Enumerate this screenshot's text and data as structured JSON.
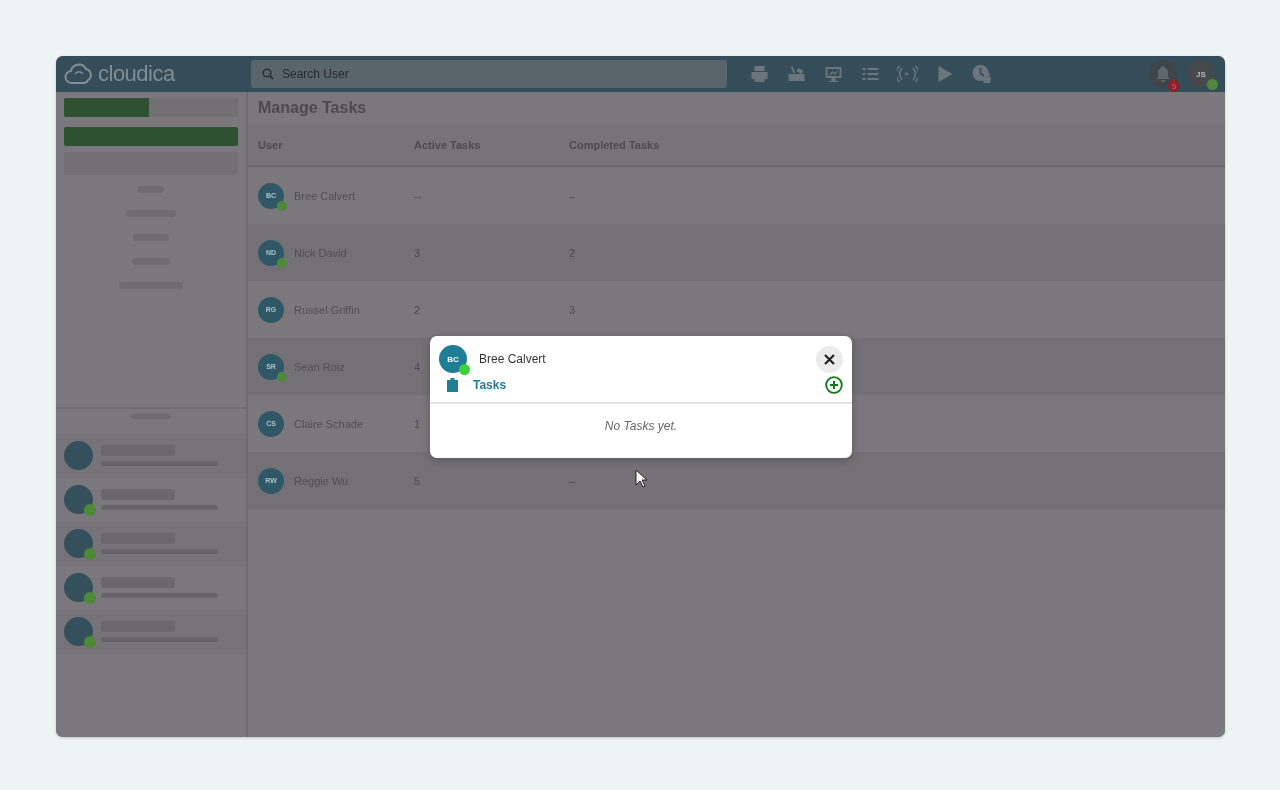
{
  "header": {
    "logo": "cloudica",
    "search": {
      "placeholder": "Search User"
    },
    "notifications": {
      "count": "5"
    },
    "account": {
      "initials": "JS",
      "online": true
    }
  },
  "sidebar": {
    "progress": {
      "level": 0.49
    },
    "contacts": [
      {
        "online": false
      },
      {
        "online": true
      },
      {
        "online": true
      },
      {
        "online": true
      },
      {
        "online": true
      }
    ]
  },
  "page": {
    "title": "Manage Tasks",
    "table": {
      "columns": [
        "User",
        "Active Tasks",
        "Completed Tasks"
      ],
      "rows": [
        {
          "initials": "BC",
          "name": "Bree Calvert",
          "online": true,
          "active_tasks": "--",
          "completed_tasks": "–"
        },
        {
          "initials": "ND",
          "name": "Nick David",
          "online": true,
          "active_tasks": "3",
          "completed_tasks": "2"
        },
        {
          "initials": "RG",
          "name": "Russel Griffin",
          "online": false,
          "active_tasks": "2",
          "completed_tasks": "3"
        },
        {
          "initials": "SR",
          "name": "Sean Roiz",
          "online": true,
          "active_tasks": "4"
        },
        {
          "initials": "CS",
          "name": "Claire Schade",
          "online": false,
          "active_tasks": "1"
        },
        {
          "initials": "RW",
          "name": "Reggie Wu",
          "online": false,
          "active_tasks": "5",
          "completed_tasks": "–"
        }
      ]
    }
  },
  "modal": {
    "user": {
      "initials": "BC",
      "name": "Bree Calvert",
      "online": true
    },
    "section": "Tasks",
    "empty_message": "No Tasks yet."
  }
}
